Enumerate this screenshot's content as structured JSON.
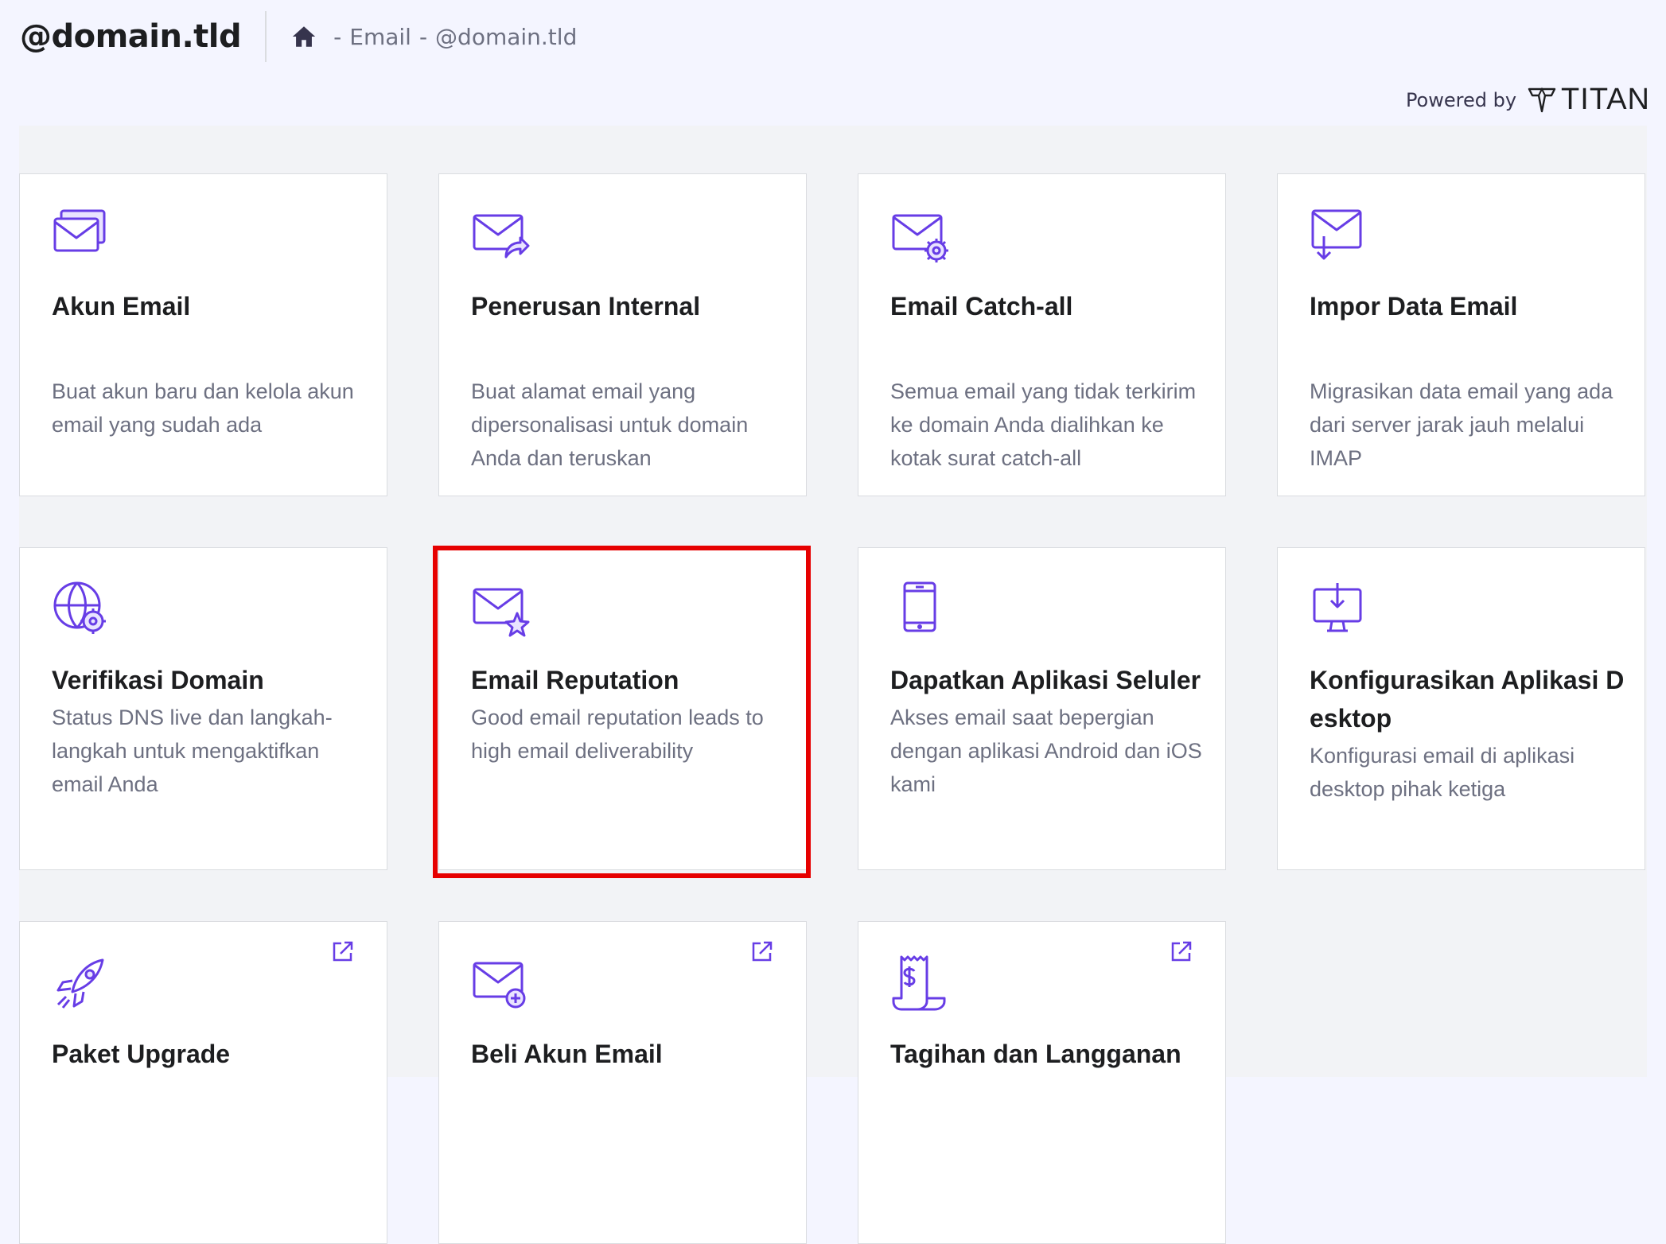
{
  "header": {
    "site_title": "@domain.tld",
    "breadcrumb": [
      "Email",
      "@domain.tld"
    ],
    "breadcrumb_sep": "-"
  },
  "powered_by": {
    "label": "Powered by",
    "brand": "TITAN"
  },
  "cards": [
    {
      "title": "Akun Email",
      "desc": "Buat akun baru dan kelola akun email yang sudah ada",
      "icon": "envelopes-icon"
    },
    {
      "title": "Penerusan Internal",
      "desc": "Buat alamat email yang dipersonalisasi untuk domain Anda dan teruskan",
      "icon": "envelope-forward-icon"
    },
    {
      "title": "Email Catch-all",
      "desc": "Semua email yang tidak terkirim ke domain Anda dialihkan ke kotak surat catch-all",
      "icon": "envelope-gear-icon"
    },
    {
      "title": "Impor Data Email",
      "desc": "Migrasikan data email yang ada dari server jarak jauh melalui IMAP",
      "icon": "envelope-import-icon"
    },
    {
      "title": "Verifikasi Domain",
      "desc": "Status DNS live dan langkah-langkah untuk mengaktifkan email Anda",
      "icon": "globe-gear-icon"
    },
    {
      "title": "Email Reputation",
      "desc": "Good email reputation leads to high email deliverability",
      "icon": "envelope-star-icon"
    },
    {
      "title": "Dapatkan Aplikasi Seluler",
      "desc": "Akses email saat bepergian dengan aplikasi Android dan iOS kami",
      "icon": "mobile-phone-icon"
    },
    {
      "title": "Konfigurasikan Aplikasi Desktop",
      "desc": "Konfigurasi email di aplikasi desktop pihak ketiga",
      "icon": "desktop-download-icon"
    },
    {
      "title": "Paket Upgrade",
      "desc": "",
      "icon": "rocket-icon",
      "external": true
    },
    {
      "title": "Beli Akun Email",
      "desc": "",
      "icon": "envelope-plus-icon",
      "external": true
    },
    {
      "title": "Tagihan dan Langganan",
      "desc": "",
      "icon": "receipt-icon",
      "external": true
    }
  ],
  "colors": {
    "accent": "#673de6",
    "highlight": "#e60000",
    "title": "#1d1e20",
    "desc": "#6d7081"
  }
}
